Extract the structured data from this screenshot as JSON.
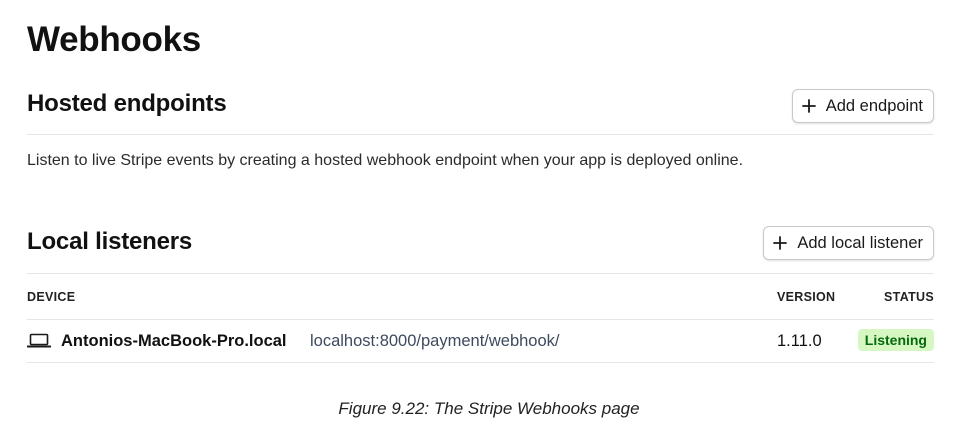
{
  "page": {
    "title": "Webhooks"
  },
  "hosted": {
    "title": "Hosted endpoints",
    "button_label": "Add endpoint",
    "description": "Listen to live Stripe events by creating a hosted webhook endpoint when your app is deployed online."
  },
  "local": {
    "title": "Local listeners",
    "button_label": "Add local listener",
    "columns": {
      "device": "DEVICE",
      "version": "VERSION",
      "status": "STATUS"
    },
    "rows": [
      {
        "device": "Antonios-MacBook-Pro.local",
        "url": "localhost:8000/payment/webhook/",
        "version": "1.11.0",
        "status": "Listening",
        "icon": "laptop-icon"
      }
    ]
  },
  "caption": "Figure 9.22: The Stripe Webhooks page",
  "colors": {
    "status_bg": "#d7f7c2",
    "status_text": "#05690d",
    "url_text": "#3e4a5e",
    "divider": "#e6e6e6"
  },
  "icons": {
    "add": "plus-icon",
    "device": "laptop-icon"
  }
}
